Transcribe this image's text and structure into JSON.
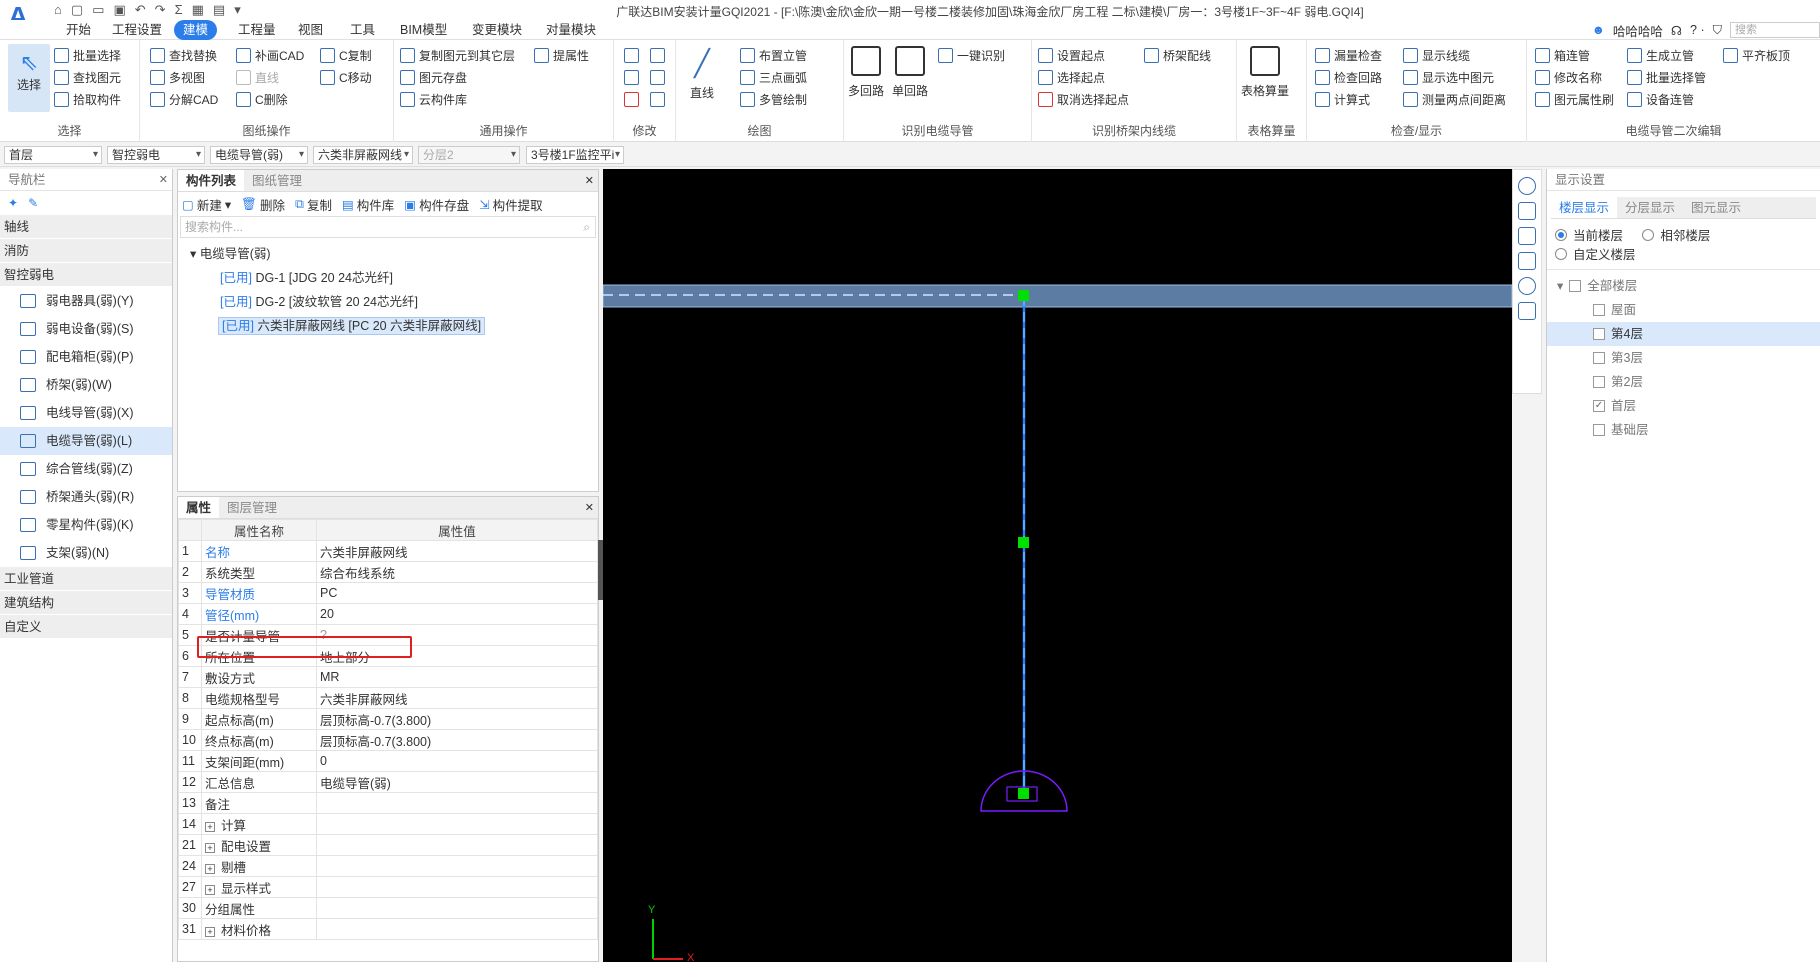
{
  "app": {
    "title": "广联达BIM安装计量GQI2021 - [F:\\陈澳\\金欣\\金欣一期一号楼二楼装修加固\\珠海金欣厂房工程 二标\\建模\\厂房一：3号楼1F~3F~4F 弱电.GQI4]",
    "user": "哈哈哈哈",
    "help": "? ·",
    "search_placeholder": "搜索"
  },
  "menus": [
    "开始",
    "工程设置",
    "建模",
    "工程量",
    "视图",
    "工具",
    "BIM模型",
    "变更模块",
    "对量模块"
  ],
  "active_menu": "建模",
  "ribbon": {
    "select": {
      "big": "选择",
      "items": [
        "批量选择",
        "查找图元",
        "拾取构件"
      ],
      "caption": "选择"
    },
    "drawing_ops": {
      "items": [
        "查找替换",
        "多视图",
        "分解CAD",
        "补画CAD",
        "直线",
        "C删除",
        "C复制",
        "C移动"
      ],
      "caption": "图纸操作"
    },
    "common_ops": {
      "items": [
        "复制图元到其它层",
        "提属性",
        "图元存盘",
        "云构件库"
      ],
      "caption": "通用操作"
    },
    "modify": {
      "caption": "修改"
    },
    "draw": {
      "big": "直线",
      "items": [
        "布置立管",
        "三点画弧",
        "多管绘制"
      ],
      "caption": "绘图"
    },
    "identify_conduit": {
      "bigs": [
        "多回路",
        "单回路"
      ],
      "items": [
        "一键识别"
      ],
      "caption": "识别电缆导管"
    },
    "identify_tray": {
      "items": [
        "设置起点",
        "选择起点",
        "取消选择起点",
        "桥架配线"
      ],
      "caption": "识别桥架内线缆"
    },
    "table_calc": {
      "big": "表格算量",
      "caption": "表格算量"
    },
    "check": {
      "items": [
        "漏量检查",
        "检查回路",
        "计算式",
        "显示线缆",
        "显示选中图元",
        "测量两点间距离"
      ],
      "caption": "检查/显示"
    },
    "edit2": {
      "items": [
        "箱连管",
        "修改名称",
        "图元属性刷",
        "生成立管",
        "批量选择管",
        "设备连管",
        "平齐板顶"
      ],
      "caption": "电缆导管二次编辑"
    }
  },
  "selectors": [
    "首层",
    "智控弱电",
    "电缆导管(弱)",
    "六类非屏蔽网线",
    "分层2",
    "3号楼1F监控平i"
  ],
  "nav": {
    "title": "导航栏",
    "cats_top": [
      "轴线",
      "消防",
      "智控弱电"
    ],
    "items": [
      "弱电器具(弱)(Y)",
      "弱电设备(弱)(S)",
      "配电箱柜(弱)(P)",
      "桥架(弱)(W)",
      "电线导管(弱)(X)",
      "电缆导管(弱)(L)",
      "综合管线(弱)(Z)",
      "桥架通头(弱)(R)",
      "零星构件(弱)(K)",
      "支架(弱)(N)"
    ],
    "cats_bottom": [
      "工业管道",
      "建筑结构",
      "自定义"
    ]
  },
  "components": {
    "tabs": [
      "构件列表",
      "图纸管理"
    ],
    "tools": [
      "新建",
      "删除",
      "复制",
      "构件库",
      "构件存盘",
      "构件提取"
    ],
    "search_placeholder": "搜索构件...",
    "root": "电缆导管(弱)",
    "items": [
      {
        "tag": "[已用]",
        "name": "DG-1 [JDG 20 24芯光纤]"
      },
      {
        "tag": "[已用]",
        "name": "DG-2 [波纹软管 20 24芯光纤]"
      },
      {
        "tag": "[已用]",
        "name": "六类非屏蔽网线 [PC 20 六类非屏蔽网线]"
      }
    ]
  },
  "properties": {
    "tabs": [
      "属性",
      "图层管理"
    ],
    "headers": [
      "属性名称",
      "属性值"
    ],
    "rows": [
      {
        "n": "1",
        "k": "名称",
        "v": "六类非屏蔽网线",
        "blue": true
      },
      {
        "n": "2",
        "k": "系统类型",
        "v": "综合布线系统",
        "blue": false
      },
      {
        "n": "3",
        "k": "导管材质",
        "v": "PC",
        "blue": true
      },
      {
        "n": "4",
        "k": "管径(mm)",
        "v": "20",
        "blue": true
      },
      {
        "n": "5",
        "k": "是否计量导管",
        "v": "?",
        "blue": false
      },
      {
        "n": "6",
        "k": "所在位置",
        "v": "地上部分",
        "blue": false
      },
      {
        "n": "7",
        "k": "敷设方式",
        "v": "MR",
        "blue": false
      },
      {
        "n": "8",
        "k": "电缆规格型号",
        "v": "六类非屏蔽网线",
        "blue": false
      },
      {
        "n": "9",
        "k": "起点标高(m)",
        "v": "层顶标高-0.7(3.800)",
        "blue": false
      },
      {
        "n": "10",
        "k": "终点标高(m)",
        "v": "层顶标高-0.7(3.800)",
        "blue": false
      },
      {
        "n": "11",
        "k": "支架间距(mm)",
        "v": "0",
        "blue": false
      },
      {
        "n": "12",
        "k": "汇总信息",
        "v": "电缆导管(弱)",
        "blue": false
      },
      {
        "n": "13",
        "k": "备注",
        "v": "",
        "blue": false
      },
      {
        "n": "14",
        "k": "计算",
        "v": "",
        "blue": false,
        "exp": true
      },
      {
        "n": "21",
        "k": "配电设置",
        "v": "",
        "blue": false,
        "exp": true
      },
      {
        "n": "24",
        "k": "剔槽",
        "v": "",
        "blue": false,
        "exp": true
      },
      {
        "n": "27",
        "k": "显示样式",
        "v": "",
        "blue": false,
        "exp": true
      },
      {
        "n": "30",
        "k": "分组属性",
        "v": "",
        "blue": false
      },
      {
        "n": "31",
        "k": "材料价格",
        "v": "",
        "blue": false,
        "exp": true
      }
    ]
  },
  "display": {
    "title": "显示设置",
    "tabs": [
      "楼层显示",
      "分层显示",
      "图元显示"
    ],
    "radios": [
      "当前楼层",
      "相邻楼层",
      "自定义楼层"
    ],
    "floors": [
      {
        "label": "全部楼层",
        "checked": false,
        "selected": false
      },
      {
        "label": "屋面",
        "checked": false,
        "selected": false
      },
      {
        "label": "第4层",
        "checked": false,
        "selected": true
      },
      {
        "label": "第3层",
        "checked": false,
        "selected": false
      },
      {
        "label": "第2层",
        "checked": false,
        "selected": false
      },
      {
        "label": "首层",
        "checked": true,
        "selected": false
      },
      {
        "label": "基础层",
        "checked": false,
        "selected": false
      }
    ]
  },
  "canvas": {
    "axis_x": "X",
    "axis_y": "Y"
  }
}
